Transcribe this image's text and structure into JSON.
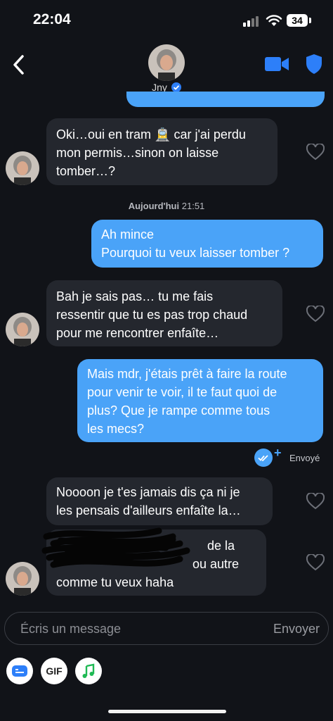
{
  "status_bar": {
    "time": "22:04",
    "battery": "34"
  },
  "header": {
    "contact_name": "Jny",
    "back_icon": "chevron-left-icon",
    "video_icon": "video-camera-icon",
    "shield_icon": "shield-icon"
  },
  "messages": [
    {
      "side": "in",
      "lines": [
        "Oki…oui en tram 🚊 car j'ai perdu",
        "mon permis…sinon on laisse",
        "tomber…?"
      ]
    },
    {
      "side": "out",
      "lines": [
        "Ah mince",
        "Pourquoi tu veux laisser tomber ?"
      ]
    },
    {
      "side": "in",
      "lines": [
        "Bah je sais pas… tu me fais",
        "ressentir que tu es pas trop chaud",
        "pour me rencontrer enfaîte…"
      ]
    },
    {
      "side": "out",
      "lines": [
        "Mais mdr, j'étais prêt à faire la route",
        "pour venir te voir, il te faut quoi de",
        "plus? Que je rampe comme tous",
        "les mecs?"
      ]
    },
    {
      "side": "in",
      "lines": [
        "Noooon je t'es jamais dis ça ni je",
        "les pensais d'ailleurs enfaîte la…"
      ]
    },
    {
      "side": "in",
      "lines": [
        "de la",
        "ou autre",
        "comme tu veux haha"
      ]
    }
  ],
  "date_separator": {
    "day": "Aujourd'hui",
    "time": "21:51"
  },
  "delivery_status": "Envoyé",
  "composer": {
    "placeholder": "Écris un message",
    "send_label": "Envoyer"
  },
  "toolbar": {
    "gif_label": "GIF",
    "icons": [
      "sticker-icon",
      "gif-icon",
      "music-note-icon"
    ]
  },
  "colors": {
    "background": "#111318",
    "incoming_bubble": "#24272e",
    "outgoing_bubble": "#4aa3f8",
    "accent": "#2d7ff9"
  }
}
